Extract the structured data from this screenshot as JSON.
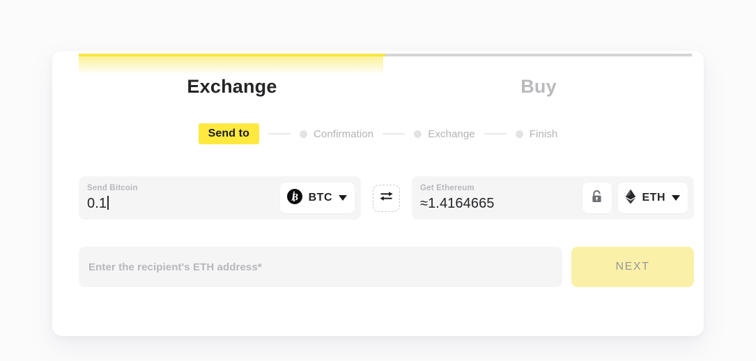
{
  "card": {
    "tabs": [
      {
        "label": "Exchange",
        "state": "active"
      },
      {
        "label": "Buy",
        "state": "inactive"
      }
    ],
    "progress": {
      "active_color": "#f7e543",
      "inactive_color": "#d3d4d6"
    },
    "steps": [
      {
        "label": "Send to",
        "state": "active"
      },
      {
        "label": "Confirmation",
        "state": "inactive"
      },
      {
        "label": "Exchange",
        "state": "inactive"
      },
      {
        "label": "Finish",
        "state": "inactive"
      }
    ],
    "send": {
      "label": "Send Bitcoin",
      "value": "0.1",
      "currency_code": "BTC",
      "currency_icon": "bitcoin-icon"
    },
    "swap": {
      "icon": "swap-arrows-icon"
    },
    "get": {
      "label": "Get Ethereum",
      "value": "≈1.4164665",
      "currency_code": "ETH",
      "currency_icon": "ethereum-icon",
      "lock_icon": "padlock-icon"
    },
    "address": {
      "placeholder": "Enter the recipient's ETH address*",
      "value": ""
    },
    "next_button": {
      "label": "NEXT",
      "color": "#fbf0a8"
    },
    "accent_color": "#ffe93f"
  }
}
